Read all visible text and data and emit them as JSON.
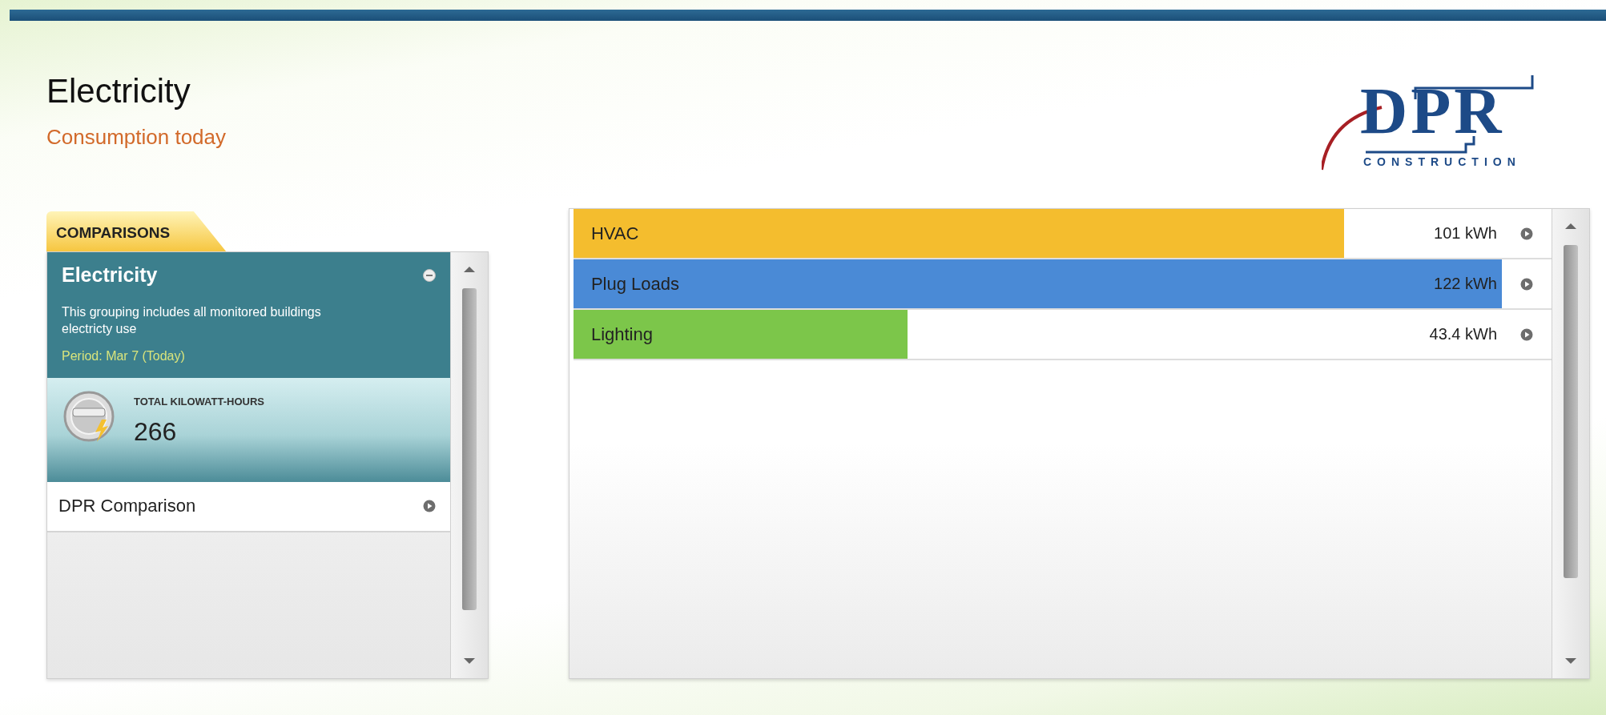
{
  "header": {
    "title": "Electricity",
    "subtitle": "Consumption today"
  },
  "logo": {
    "name": "DPR",
    "tagline": "CONSTRUCTION"
  },
  "comparisons": {
    "tab": "COMPARISONS",
    "group": {
      "title": "Electricity",
      "expanded": true,
      "description": "This grouping includes all monitored buildings electricty use",
      "period": "Period: Mar 7 (Today)",
      "total_label": "TOTAL KILOWATT-HOURS",
      "total": "266"
    },
    "items": [
      {
        "label": "DPR Comparison"
      }
    ]
  },
  "usage": [
    {
      "name": "HVAC",
      "reading": "101 kWh",
      "level": 0.83,
      "color": "#f4bd2e"
    },
    {
      "name": "Plug Loads",
      "reading": "122 kWh",
      "level": 1.0,
      "color": "#4a8ad6"
    },
    {
      "name": "Lighting",
      "reading": "43.4 kWh",
      "level": 0.36,
      "color": "#7cc64a"
    }
  ]
}
